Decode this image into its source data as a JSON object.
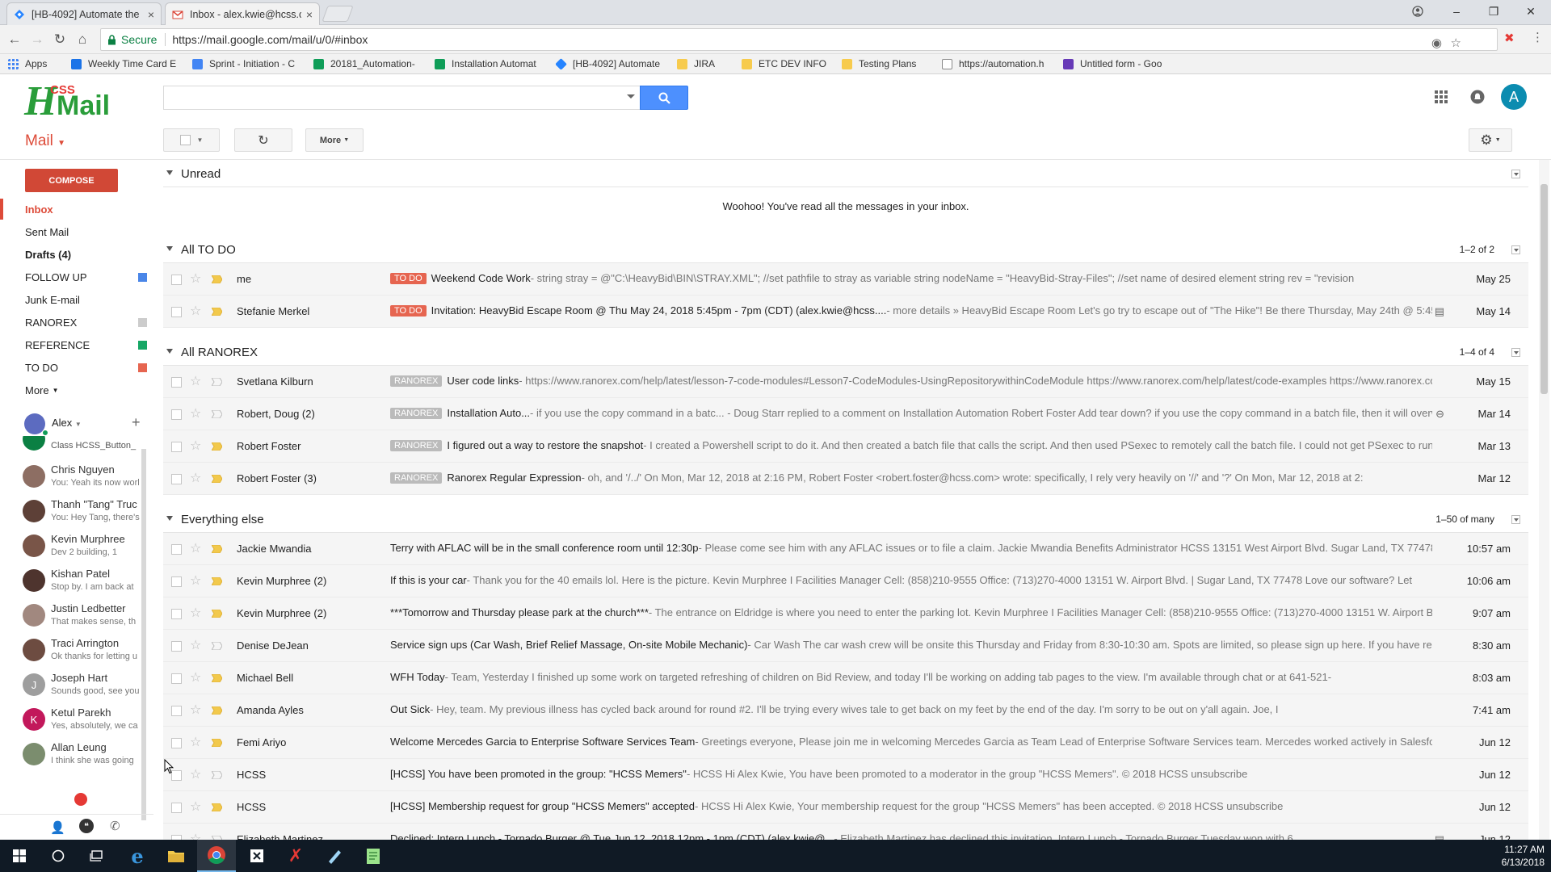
{
  "browser": {
    "tabs": [
      {
        "title": "[HB-4092] Automate the",
        "active": false
      },
      {
        "title": "Inbox - alex.kwie@hcss.c",
        "active": true
      }
    ],
    "address": {
      "secure_label": "Secure",
      "url": "https://mail.google.com/mail/u/0/#inbox"
    },
    "bookmarks": [
      {
        "label": "Apps",
        "color": "#4285f4"
      },
      {
        "label": "Weekly Time Card E",
        "color": "#1a73e8"
      },
      {
        "label": "Sprint - Initiation - C",
        "color": "#4285f4"
      },
      {
        "label": "20181_Automation-",
        "color": "#0f9d58"
      },
      {
        "label": "Installation Automat",
        "color": "#0f9d58"
      },
      {
        "label": "[HB-4092] Automate",
        "color": "#2684ff"
      },
      {
        "label": "JIRA",
        "color": "#f7cb4d"
      },
      {
        "label": "ETC DEV INFO",
        "color": "#f7cb4d"
      },
      {
        "label": "Testing Plans",
        "color": "#f7cb4d"
      },
      {
        "label": "https://automation.h",
        "color": "#888888"
      },
      {
        "label": "Untitled form - Goo",
        "color": "#673ab7"
      }
    ]
  },
  "gmail": {
    "logo_text": "HCSS Mail",
    "avatar_letter": "A",
    "mail_menu": "Mail",
    "more_button": "More",
    "compose": "COMPOSE",
    "nav": [
      {
        "label": "Inbox",
        "active": true,
        "color": ""
      },
      {
        "label": "Sent Mail",
        "active": false,
        "color": ""
      },
      {
        "label": "Drafts (4)",
        "active": false,
        "bold": true,
        "color": ""
      },
      {
        "label": "FOLLOW UP",
        "active": false,
        "color": "#4a86e8"
      },
      {
        "label": "Junk E-mail",
        "active": false,
        "color": ""
      },
      {
        "label": "RANOREX",
        "active": false,
        "color": "#cccccc"
      },
      {
        "label": "REFERENCE",
        "active": false,
        "color": "#16a765"
      },
      {
        "label": "TO DO",
        "active": false,
        "color": "#e66550"
      },
      {
        "label": "More",
        "active": false,
        "color": ""
      }
    ],
    "hangouts_user": "Alex",
    "contacts": [
      {
        "name": "Class HCSS_Button_",
        "msg": "",
        "color": "#0b8043",
        "initial": ""
      },
      {
        "name": "Chris Nguyen",
        "msg": "You: Yeah its now worl",
        "color": "#8d6e63",
        "initial": ""
      },
      {
        "name": "Thanh \"Tang\" Truc",
        "msg": "You: Hey Tang, there's",
        "color": "#5d4037",
        "initial": ""
      },
      {
        "name": "Kevin Murphree",
        "msg": "Dev 2 building, 1",
        "color": "#795548",
        "initial": ""
      },
      {
        "name": "Kishan Patel",
        "msg": "Stop by. I am back at",
        "color": "#4e342e",
        "initial": ""
      },
      {
        "name": "Justin Ledbetter",
        "msg": "That makes sense, th",
        "color": "#a1887f",
        "initial": ""
      },
      {
        "name": "Traci Arrington",
        "msg": "Ok thanks for letting u",
        "color": "#6d4c41",
        "initial": ""
      },
      {
        "name": "Joseph Hart",
        "msg": "Sounds good, see you",
        "color": "#9e9e9e",
        "initial": "J"
      },
      {
        "name": "Ketul Parekh",
        "msg": "Yes, absolutely, we ca",
        "color": "#c2185b",
        "initial": "K"
      },
      {
        "name": "Allan Leung",
        "msg": "I think she was going",
        "color": "#7b8d6e",
        "initial": ""
      }
    ],
    "sections": [
      {
        "name": "Unread",
        "count": "",
        "empty_msg": "Woohoo! You've read all the messages in your inbox."
      },
      {
        "name": "All TO DO",
        "count": "1–2 of 2"
      },
      {
        "name": "All RANOREX",
        "count": "1–4 of 4"
      },
      {
        "name": "Everything else",
        "count": "1–50 of many"
      }
    ],
    "todo_rows": [
      {
        "from": "me",
        "label": "TO DO",
        "subject": "Weekend Code Work",
        "snippet": " - string stray = @\"C:\\HeavyBid\\BIN\\STRAY.XML\"; //set pathfile to stray as variable string nodeName = \"HeavyBid-Stray-Files\"; //set name of desired element string rev = \"revision",
        "date": "May 25",
        "important": true,
        "attach": ""
      },
      {
        "from": "Stefanie Merkel",
        "label": "TO DO",
        "subject": "Invitation: HeavyBid Escape Room @ Thu May 24, 2018 5:45pm - 7pm (CDT) (alex.kwie@hcss....",
        "snippet": " - more details » HeavyBid Escape Room Let's go try to escape out of \"The Hike\"! Be there Thursday, May 24th @ 5:45pm",
        "date": "May 14",
        "important": true,
        "attach": "calendar"
      }
    ],
    "ranorex_rows": [
      {
        "from": "Svetlana Kilburn",
        "label": "RANOREX",
        "subject": "User code links",
        "snippet": " - https://www.ranorex.com/help/latest/lesson-7-code-modules#Lesson7-CodeModules-UsingRepositorywithinCodeModule https://www.ranorex.com/help/latest/code-examples https://www.ranorex.com/l",
        "date": "May 15",
        "important": false,
        "attach": ""
      },
      {
        "from": "Robert, Doug (2)",
        "label": "RANOREX",
        "subject": "Installation Auto...",
        "snippet": " - if you use the copy command in a batc... - Doug Starr replied to a comment on Installation Automation Robert Foster Add tear down? if you use the copy command in a batch file, then it will overwrit",
        "date": "Mar 14",
        "important": false,
        "attach": "link"
      },
      {
        "from": "Robert Foster",
        "label": "RANOREX",
        "subject": "I figured out a way to restore the snapshot",
        "snippet": " - I created a Powershell script to do it. And then created a batch file that calls the script. And then used PSexec to remotely call the batch file. I could not get PSexec to run the",
        "date": "Mar 13",
        "important": true,
        "attach": ""
      },
      {
        "from": "Robert Foster (3)",
        "label": "RANOREX",
        "subject": "Ranorex Regular Expression",
        "snippet": " - oh, and '/../' On Mon, Mar 12, 2018 at 2:16 PM, Robert Foster <robert.foster@hcss.com> wrote: specifically, I rely very heavily on '//' and '?' On Mon, Mar 12, 2018 at 2:",
        "date": "Mar 12",
        "important": true,
        "attach": ""
      }
    ],
    "other_rows": [
      {
        "from": "Jackie Mwandia",
        "subject": "Terry with AFLAC will be in the small conference room until 12:30p",
        "snippet": " - Please come see him with any AFLAC issues or to file a claim. Jackie Mwandia Benefits Administrator HCSS 13151 West Airport Blvd. Sugar Land, TX 77478 71",
        "date": "10:57 am",
        "important": true,
        "attach": ""
      },
      {
        "from": "Kevin Murphree (2)",
        "subject": "If this is your car",
        "snippet": " - Thank you for the 40 emails lol. Here is the picture. Kevin Murphree I Facilities Manager Cell: (858)210-9555 Office: (713)270-4000 13151 W. Airport Blvd. | Sugar Land, TX 77478 Love our software? Let",
        "date": "10:06 am",
        "important": true,
        "attach": ""
      },
      {
        "from": "Kevin Murphree (2)",
        "subject": "***Tomorrow and Thursday please park at the church***",
        "snippet": " - The entrance on Eldridge is where you need to enter the parking lot. Kevin Murphree I Facilities Manager Cell: (858)210-9555 Office: (713)270-4000 13151 W. Airport Blvd.",
        "date": "9:07 am",
        "important": true,
        "attach": ""
      },
      {
        "from": "Denise DeJean",
        "subject": "Service sign ups (Car Wash, Brief Relief Massage, On-site Mobile Mechanic)",
        "snippet": " - Car Wash The car wash crew will be onsite this Thursday and Friday from 8:30-10:30 am. Spots are limited, so please sign up here. If you have reserv",
        "date": "8:30 am",
        "important": false,
        "attach": ""
      },
      {
        "from": "Michael Bell",
        "subject": "WFH Today",
        "snippet": " - Team, Yesterday I finished up some work on targeted refreshing of children on Bid Review, and today I'll be working on adding tab pages to the view. I'm available through chat or at 641-521-",
        "date": "8:03 am",
        "important": true,
        "attach": ""
      },
      {
        "from": "Amanda Ayles",
        "subject": "Out Sick",
        "snippet": " - Hey, team. My previous illness has cycled back around for round #2. I'll be trying every wives tale to get back on my feet by the end of the day. I'm sorry to be out on y'all again. Joe, I",
        "date": "7:41 am",
        "important": true,
        "attach": ""
      },
      {
        "from": "Femi Ariyo",
        "subject": "Welcome Mercedes Garcia to Enterprise Software Services Team",
        "snippet": " - Greetings everyone, Please join me in welcoming Mercedes Garcia as Team Lead of Enterprise Software Services team. Mercedes worked actively in Salesforce,",
        "date": "Jun 12",
        "important": true,
        "attach": ""
      },
      {
        "from": "HCSS",
        "subject": "[HCSS] You have been promoted in the group: \"HCSS Memers\"",
        "snippet": " - HCSS Hi Alex Kwie, You have been promoted to a moderator in the group \"HCSS Memers\". © 2018 HCSS unsubscribe",
        "date": "Jun 12",
        "important": false,
        "attach": ""
      },
      {
        "from": "HCSS",
        "subject": "[HCSS] Membership request for group \"HCSS Memers\" accepted",
        "snippet": " - HCSS Hi Alex Kwie, Your membership request for the group \"HCSS Memers\" has been accepted. © 2018 HCSS unsubscribe",
        "date": "Jun 12",
        "important": true,
        "attach": ""
      },
      {
        "from": "Elizabeth Martinez",
        "subject": "Declined: Intern Lunch - Tornado Burger @ Tue Jun 12, 2018 12pm - 1pm (CDT) (alex.kwie@...",
        "snippet": " - Elizabeth Martinez has declined this invitation. Intern Lunch - Tornado Burger Tuesday won with 6",
        "date": "Jun 12",
        "important": false,
        "attach": "calendar"
      }
    ]
  },
  "taskbar": {
    "time": "11:27 AM",
    "date": "6/13/2018"
  },
  "colors": {
    "accent_red": "#dd4b39",
    "compose": "#d14836",
    "search_blue": "#4d90fe",
    "todo_label": "#e66550",
    "ranorex_label": "#bbbbbb"
  }
}
